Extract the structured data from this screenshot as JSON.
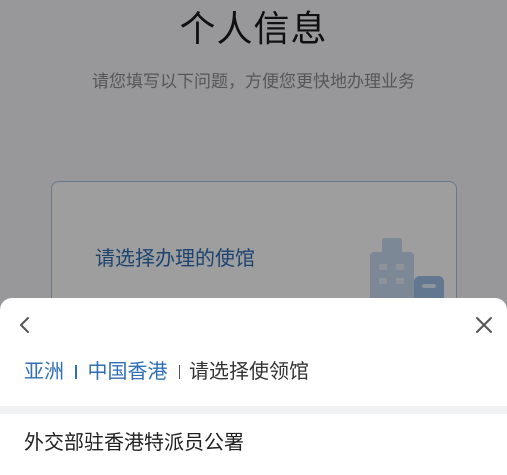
{
  "page": {
    "title": "个人信息",
    "subtitle": "请您填写以下问题，方便您更快地办理业务"
  },
  "select_card": {
    "label": "请选择办理的使馆"
  },
  "sheet": {
    "back_icon": "chevron-left-icon",
    "close_icon": "close-icon",
    "breadcrumb": {
      "level1": "亚洲",
      "level2": "中国香港",
      "current": "请选择使领馆"
    },
    "list": [
      "外交部驻香港特派员公署"
    ]
  },
  "colors": {
    "accent": "#2f6fb6",
    "overlay": "rgba(0,0,0,0.38)",
    "text": "#222222"
  }
}
